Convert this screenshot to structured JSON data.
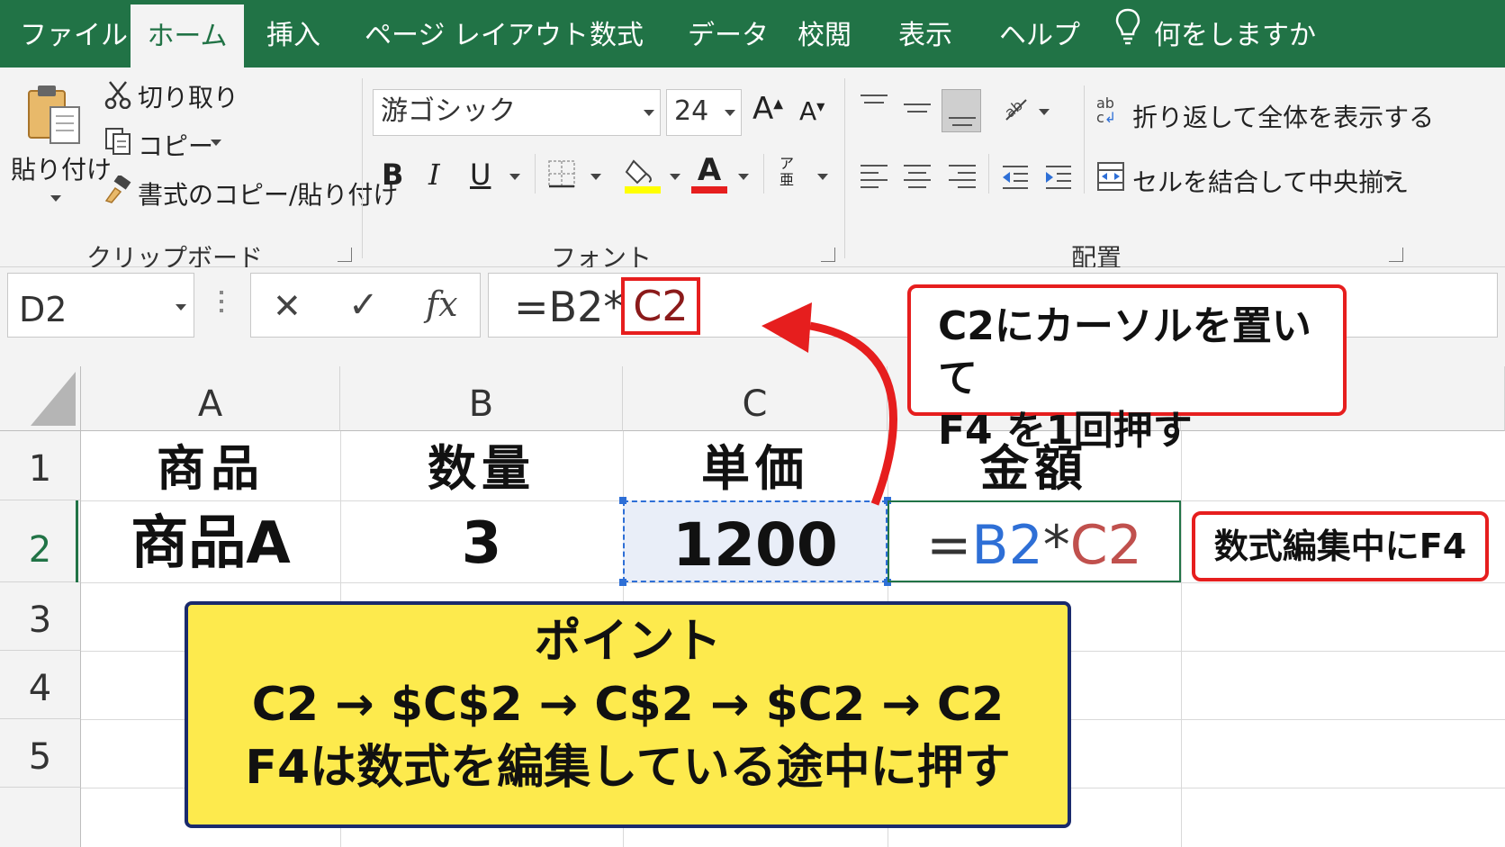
{
  "tabs": [
    "ファイル",
    "ホーム",
    "挿入",
    "ページ レイアウト",
    "数式",
    "データ",
    "校閲",
    "表示",
    "ヘルプ"
  ],
  "tell_me": "何をしますか",
  "clipboard": {
    "paste_label": "貼り付け",
    "cut_label": "切り取り",
    "copy_label": "コピー",
    "format_painter_label": "書式のコピー/貼り付け",
    "group_label": "クリップボード"
  },
  "font": {
    "font_name": "游ゴシック",
    "font_size": "24",
    "bold": "B",
    "italic": "I",
    "underline": "U",
    "font_color_glyph": "A",
    "grow_glyph": "A",
    "shrink_glyph": "A",
    "phonetic_glyph": "ア",
    "phonetic_sub": "亜",
    "group_label": "フォント"
  },
  "alignment": {
    "wrap_label": "折り返して全体を表示する",
    "merge_label": "セルを結合して中央揃え",
    "wrap_icon_top": "ab",
    "wrap_icon_bottom": "c",
    "group_label": "配置"
  },
  "formula_bar": {
    "name_box": "D2",
    "cancel": "✕",
    "enter": "✓",
    "fx": "fx",
    "formula_prefix": "=B2*",
    "formula_highlight": "C2"
  },
  "columns": [
    "A",
    "B",
    "C"
  ],
  "rows": [
    "1",
    "2",
    "3",
    "4",
    "5"
  ],
  "cells": {
    "A1": "商品",
    "B1": "数量",
    "C1": "単価",
    "D1": "金額",
    "A2": "商品A",
    "B2": "3",
    "C2": "1200",
    "D2_eq": "=",
    "D2_ref1": "B2",
    "D2_op": "*",
    "D2_ref2": "C2"
  },
  "callouts": {
    "top_line1": "C2にカーソルを置いて",
    "top_line2": "F4 を1回押す",
    "side": "数式編集中にF4",
    "point_title": "ポイント",
    "point_line1": "C2 → $C$2 → C$2 → $C2 → C2",
    "point_line2": "F4は数式を編集している途中に押す"
  },
  "colors": {
    "excel_green": "#217346",
    "callout_red": "#e61e1e",
    "ref_blue": "#2e6fd6",
    "ref_red": "#c0504d",
    "point_yellow": "#fdea4d",
    "point_border": "#1a2a6c"
  }
}
